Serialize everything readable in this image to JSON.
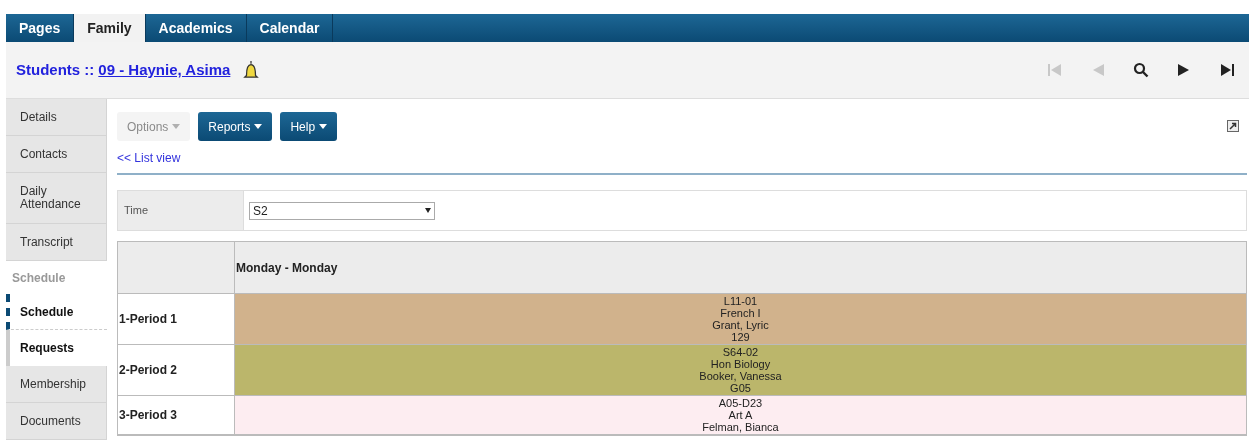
{
  "top_tabs": [
    {
      "label": "Pages",
      "selected": false
    },
    {
      "label": "Family",
      "selected": true
    },
    {
      "label": "Academics",
      "selected": false
    },
    {
      "label": "Calendar",
      "selected": false
    }
  ],
  "breadcrumb": {
    "prefix": "Students ::",
    "link": "09 - Haynie, Asima"
  },
  "nav_buttons": [
    {
      "kind": "first",
      "disabled": true
    },
    {
      "kind": "prev",
      "disabled": true
    },
    {
      "kind": "search",
      "disabled": false
    },
    {
      "kind": "next",
      "disabled": false
    },
    {
      "kind": "last",
      "disabled": false
    }
  ],
  "sidebar": [
    {
      "kind": "tab",
      "label": "Details",
      "selected": false
    },
    {
      "kind": "tab",
      "label": "Contacts",
      "selected": false
    },
    {
      "kind": "tab",
      "label": "Daily Attendance",
      "selected": false
    },
    {
      "kind": "tab",
      "label": "Transcript",
      "selected": false
    },
    {
      "kind": "section",
      "label": "Schedule"
    },
    {
      "kind": "subtab",
      "label": "Schedule",
      "selected": true
    },
    {
      "kind": "subtab",
      "label": "Requests",
      "selected": false
    },
    {
      "kind": "tab",
      "label": "Membership",
      "selected": false
    },
    {
      "kind": "tab",
      "label": "Documents",
      "selected": false
    }
  ],
  "toolbar": [
    {
      "label": "Options",
      "disabled": true
    },
    {
      "label": "Reports",
      "disabled": false
    },
    {
      "label": "Help",
      "disabled": false
    }
  ],
  "list_view_link": "<< List view",
  "filter": {
    "label": "Time",
    "value": "S2"
  },
  "schedule": {
    "column_header": "Monday - Monday",
    "rows": [
      {
        "period": "1-Period 1",
        "color": "#d1b28c",
        "lines": [
          "L11-01",
          "French I",
          "Grant, Lyric",
          "129"
        ]
      },
      {
        "period": "2-Period 2",
        "color": "#bbb66b",
        "lines": [
          "S64-02",
          "Hon Biology",
          "Booker, Vanessa",
          "G05"
        ]
      },
      {
        "period": "3-Period 3",
        "color": "#fdedf1",
        "lines": [
          "A05-D23",
          "Art A",
          "Felman, Bianca"
        ]
      }
    ]
  }
}
